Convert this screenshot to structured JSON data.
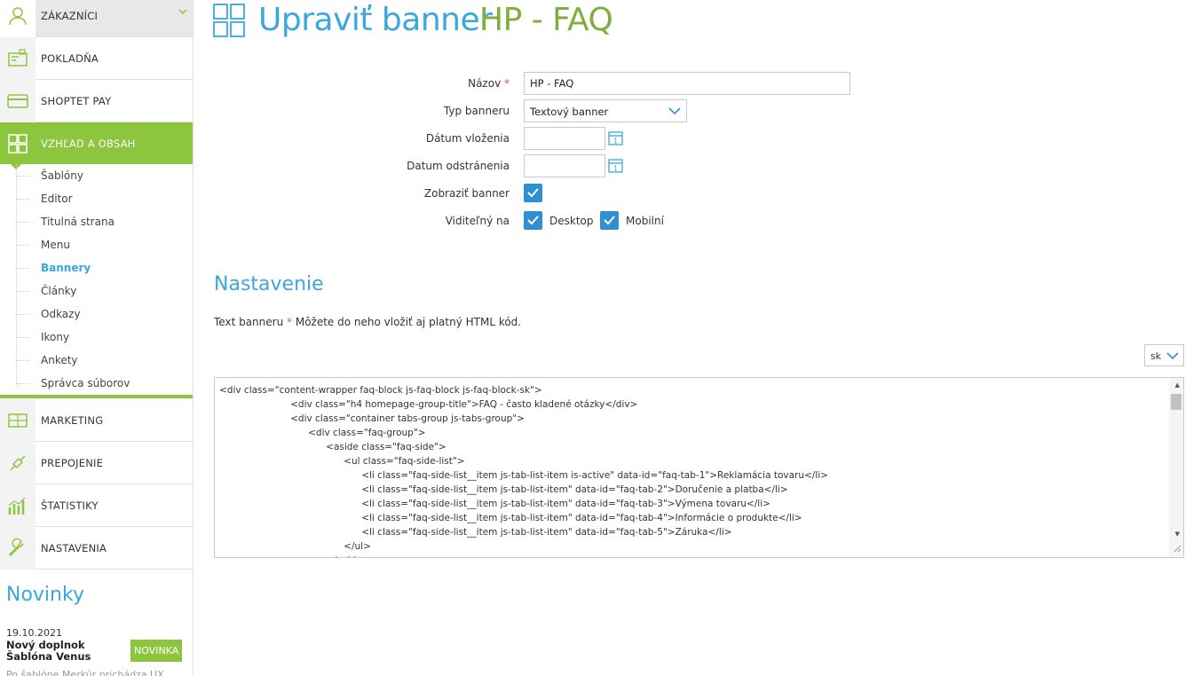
{
  "sidebar": {
    "nav": [
      {
        "label": "ZÁKAZNÍCI",
        "icon": "user-icon"
      },
      {
        "label": "POKLADŇA",
        "icon": "cash-register-icon"
      },
      {
        "label": "SHOPTET PAY",
        "icon": "credit-card-icon"
      },
      {
        "label": "VZHĽAD A OBSAH",
        "icon": "layout-grid-icon"
      },
      {
        "label": "MARKETING",
        "icon": "megaphone-icon"
      },
      {
        "label": "PREPOJENIE",
        "icon": "plug-icon"
      },
      {
        "label": "ŠTATISTIKY",
        "icon": "bar-chart-icon"
      },
      {
        "label": "NASTAVENIA",
        "icon": "wrench-icon"
      }
    ],
    "submenu": [
      "Šablóny",
      "Editor",
      "Titulná strana",
      "Menu",
      "Bannery",
      "Články",
      "Odkazy",
      "Ikony",
      "Ankety",
      "Správca súborov"
    ],
    "news": {
      "title": "Novinky",
      "date": "19.10.2021",
      "headline": "Nový doplnok Šablóna Venus",
      "badge": "NOVINKA",
      "preview": "Po šablóne Merkúr prichádza UX"
    }
  },
  "header": {
    "title": "Upraviť banner",
    "subtitle": "HP - FAQ"
  },
  "form": {
    "name_label": "Názov",
    "name_value": "HP - FAQ",
    "type_label": "Typ banneru",
    "type_value": "Textový banner",
    "date_insert_label": "Dátum vloženia",
    "date_remove_label": "Datum odstránenia",
    "show_label": "Zobraziť banner",
    "visible_label": "Viditeľný na",
    "desktop_label": "Desktop",
    "mobile_label": "Mobilní",
    "required_mark": "*"
  },
  "settings": {
    "title": "Nastavenie",
    "text_label": "Text banneru",
    "text_hint": "Môžete do neho vložiť aj platný HTML kód.",
    "lang": "sk",
    "code_lines": [
      "<div class=\"content-wrapper faq-block js-faq-block js-faq-block-sk\">",
      "                        <div class=\"h4 homepage-group-title\">FAQ - často kladené otázky</div>",
      "                        <div class=\"container tabs-group js-tabs-group\">",
      "                              <div class=\"faq-group\">",
      "                                    <aside class=\"faq-side\">",
      "                                          <ul class=\"faq-side-list\">",
      "                                                <li class=\"faq-side-list__item js-tab-list-item is-active\" data-id=\"faq-tab-1\">Reklamácia tovaru</li>",
      "                                                <li class=\"faq-side-list__item js-tab-list-item\" data-id=\"faq-tab-2\">Doručenie a platba</li>",
      "                                                <li class=\"faq-side-list__item js-tab-list-item\" data-id=\"faq-tab-3\">Výmena tovaru</li>",
      "                                                <li class=\"faq-side-list__item js-tab-list-item\" data-id=\"faq-tab-4\">Informácie o produkte</li>",
      "                                                <li class=\"faq-side-list__item js-tab-list-item\" data-id=\"faq-tab-5\">Záruka</li>",
      "                                          </ul>",
      "                                    </aside>"
    ]
  },
  "colors": {
    "accent_green": "#8cc63f",
    "accent_blue": "#3aa7dd",
    "subtitle_green": "#7fae3e",
    "checkbox_blue": "#2f8fd0"
  }
}
